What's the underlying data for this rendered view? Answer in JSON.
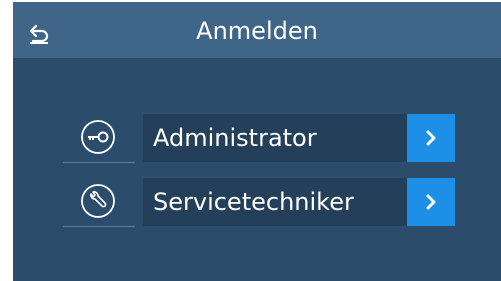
{
  "header": {
    "title": "Anmelden",
    "back_icon": "back-arrow-icon"
  },
  "users": [
    {
      "label": "Administrator",
      "icon": "key-icon"
    },
    {
      "label": "Servicetechniker",
      "icon": "wrench-icon"
    }
  ],
  "colors": {
    "background": "#2b4c6a",
    "header": "#3f6689",
    "button": "#243f59",
    "accent": "#1e8fe6",
    "text": "#ffffff"
  }
}
